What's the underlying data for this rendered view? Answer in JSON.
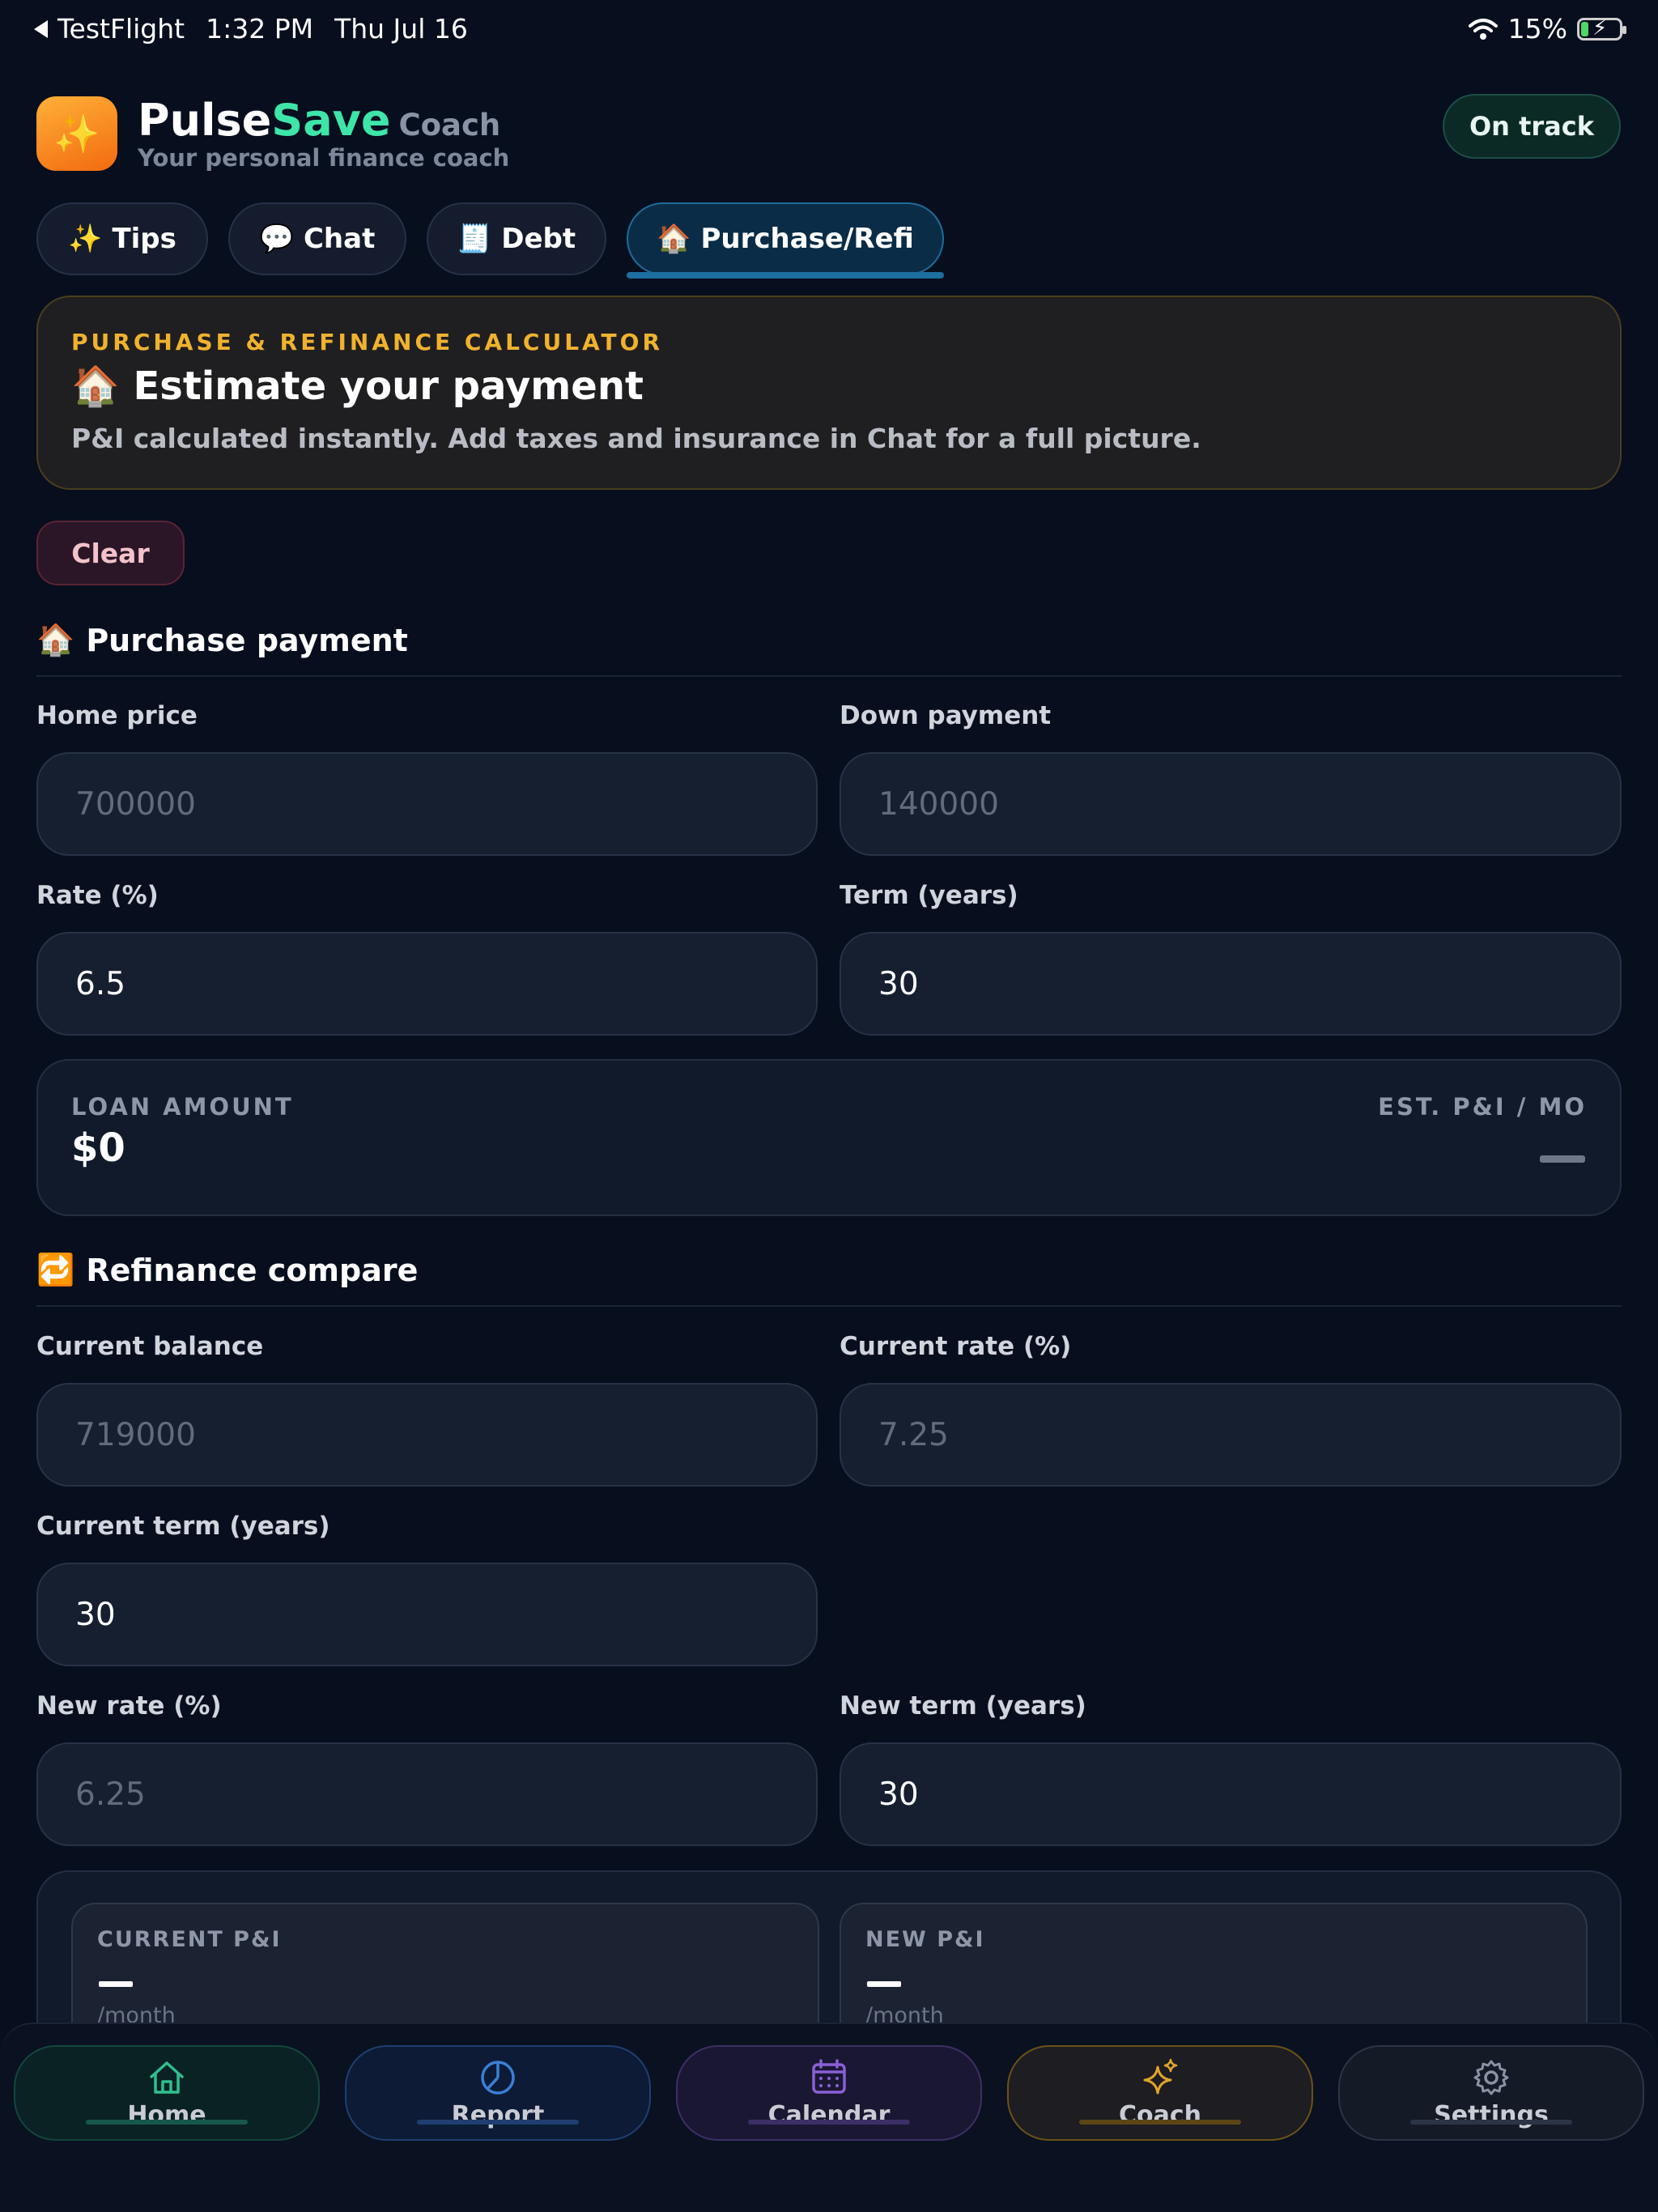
{
  "status_bar": {
    "back_app": "TestFlight",
    "time": "1:32 PM",
    "date": "Thu Jul 16",
    "battery": "15%"
  },
  "header": {
    "brand_pulse": "Pulse",
    "brand_save": "Save",
    "brand_coach": "Coach",
    "tagline": "Your personal finance coach",
    "status_pill": "On track",
    "app_icon_emoji": "✨"
  },
  "tabs": [
    {
      "icon": "✨",
      "label": "Tips"
    },
    {
      "icon": "💬",
      "label": "Chat"
    },
    {
      "icon": "🧾",
      "label": "Debt"
    },
    {
      "icon": "🏠",
      "label": "Purchase/Refi",
      "active": true
    }
  ],
  "calculator": {
    "eyebrow": "PURCHASE & REFINANCE CALCULATOR",
    "title_icon": "🏠",
    "title": "Estimate your payment",
    "description": "P&I calculated instantly. Add taxes and insurance in Chat for a full picture."
  },
  "clear_label": "Clear",
  "purchase": {
    "section_icon": "🏠",
    "section_title": "Purchase payment",
    "home_price_label": "Home price",
    "home_price_placeholder": "700000",
    "down_payment_label": "Down payment",
    "down_payment_placeholder": "140000",
    "rate_label": "Rate (%)",
    "rate_value": "6.5",
    "term_label": "Term (years)",
    "term_value": "30",
    "loan_amount_label": "LOAN AMOUNT",
    "loan_amount_value": "$0",
    "est_pi_label": "EST. P&I / MO",
    "est_pi_value": "—"
  },
  "refinance": {
    "section_icon": "🔁",
    "section_title": "Refinance compare",
    "current_balance_label": "Current balance",
    "current_balance_placeholder": "719000",
    "current_rate_label": "Current rate (%)",
    "current_rate_placeholder": "7.25",
    "current_term_label": "Current term (years)",
    "current_term_value": "30",
    "new_rate_label": "New rate (%)",
    "new_rate_placeholder": "6.25",
    "new_term_label": "New term (years)",
    "new_term_value": "30",
    "current_pi_label": "CURRENT P&I",
    "current_pi_value": "—",
    "current_pi_unit": "/month",
    "new_pi_label": "NEW P&I",
    "new_pi_value": "—",
    "new_pi_unit": "/month"
  },
  "bottom_nav": [
    {
      "label": "Home",
      "icon": "home-icon",
      "color": "#2fbf8f"
    },
    {
      "label": "Report",
      "icon": "pie-chart-icon",
      "color": "#3b7fd6"
    },
    {
      "label": "Calendar",
      "icon": "calendar-icon",
      "color": "#8a5fd6"
    },
    {
      "label": "Coach",
      "icon": "sparkles-icon",
      "color": "#e0a42a"
    },
    {
      "label": "Settings",
      "icon": "gear-icon",
      "color": "#8a93a6"
    }
  ]
}
